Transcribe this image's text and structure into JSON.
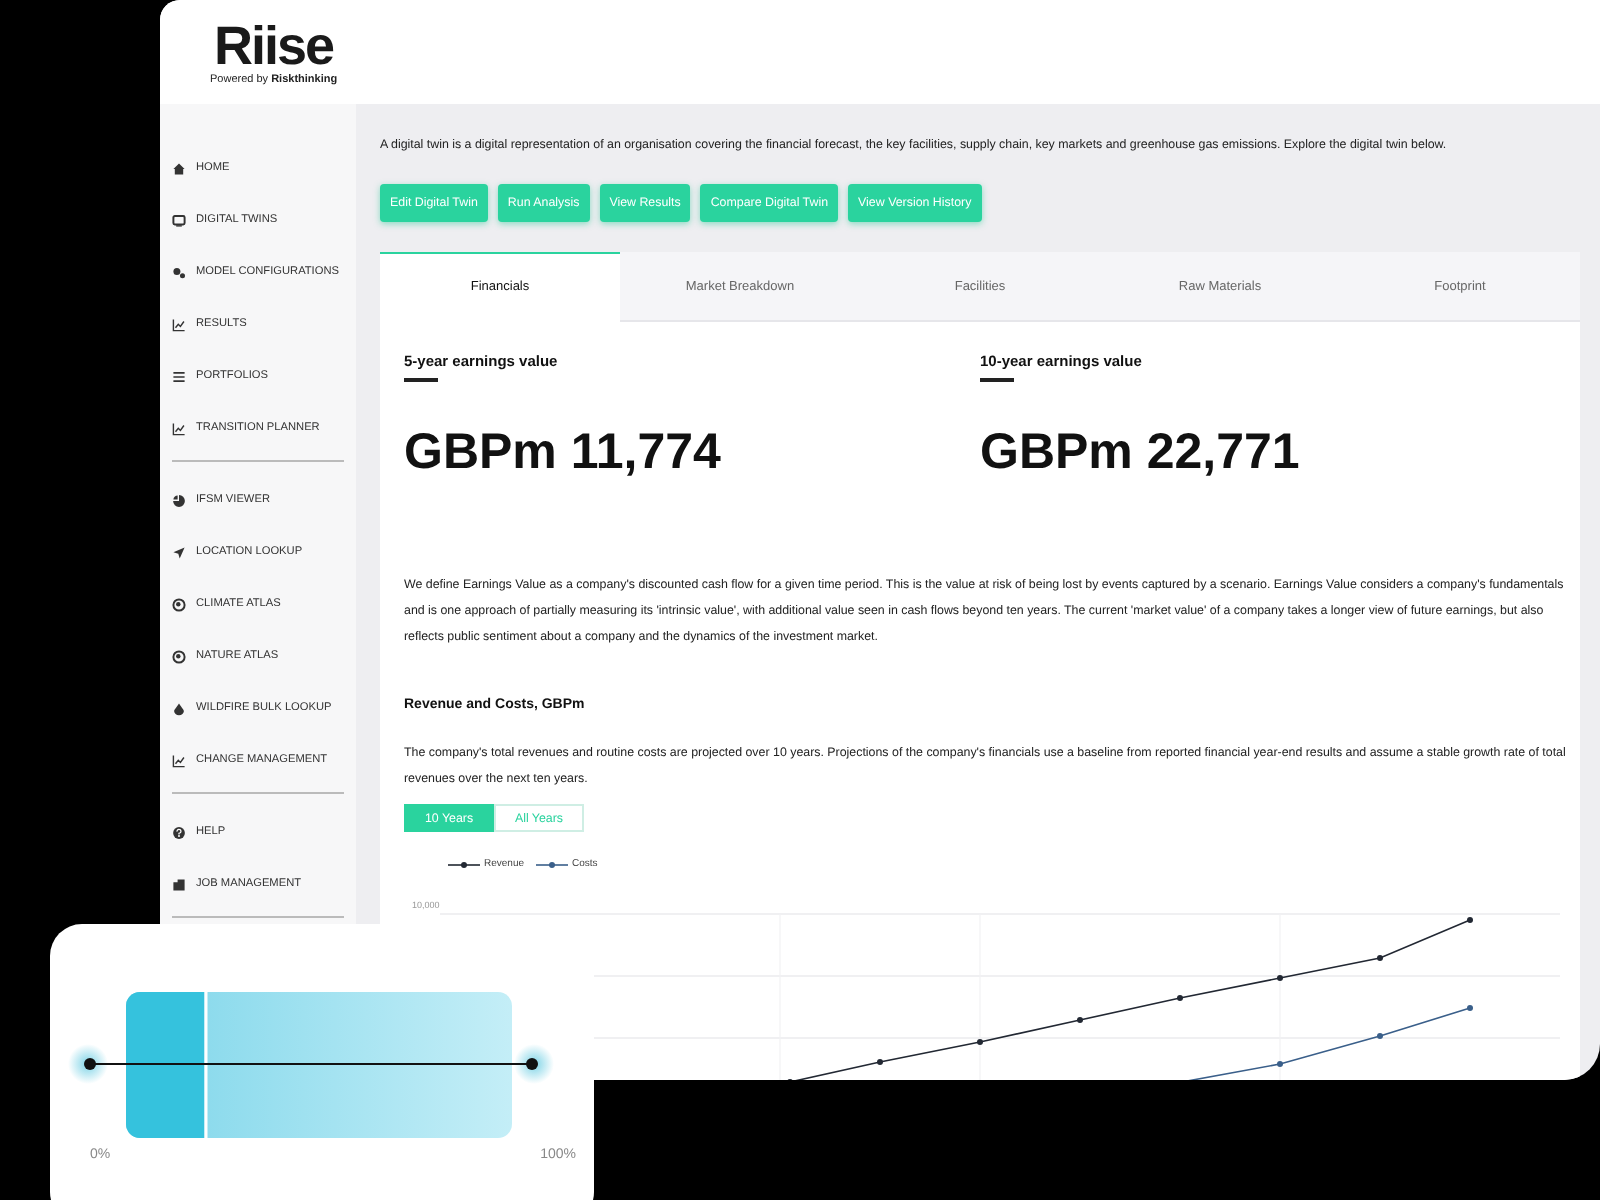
{
  "logo": {
    "name": "Riise",
    "tagline": "Powered by **Riskthinking**"
  },
  "sidebar": {
    "groups": [
      [
        {
          "label": "HOME"
        },
        {
          "label": "DIGITAL TWINS"
        },
        {
          "label": "MODEL CONFIGURATIONS"
        },
        {
          "label": "RESULTS"
        },
        {
          "label": "PORTFOLIOS"
        },
        {
          "label": "TRANSITION PLANNER"
        }
      ],
      [
        {
          "label": "IFSM VIEWER"
        },
        {
          "label": "LOCATION LOOKUP"
        },
        {
          "label": "CLIMATE ATLAS"
        },
        {
          "label": "NATURE ATLAS"
        },
        {
          "label": "WILDFIRE BULK LOOKUP"
        },
        {
          "label": "CHANGE MANAGEMENT"
        }
      ],
      [
        {
          "label": "HELP"
        },
        {
          "label": "JOB MANAGEMENT"
        }
      ]
    ]
  },
  "intro": "A digital twin is a digital representation of an organisation covering the financial forecast, the key facilities, supply chain, key markets and greenhouse gas emissions. Explore the digital twin below.",
  "actions": [
    "Edit Digital Twin",
    "Run Analysis",
    "View Results",
    "Compare Digital Twin",
    "View Version History"
  ],
  "tabs": [
    {
      "label": "Financials",
      "selected": true
    },
    {
      "label": "Market Breakdown",
      "selected": false
    },
    {
      "label": "Facilities",
      "selected": false
    },
    {
      "label": "Raw Materials",
      "selected": false
    },
    {
      "label": "Footprint",
      "selected": false
    }
  ],
  "metrics": [
    {
      "label": "5-year earnings value",
      "value": "GBPm 11,774"
    },
    {
      "label": "10-year earnings value",
      "value": "GBPm 22,771"
    }
  ],
  "definition": "We define Earnings Value as a company's discounted cash flow for a given time period. This is the value at risk of being lost by events captured by a scenario. Earnings Value considers a company's fundamentals and is one approach of partially measuring its 'intrinsic value', with additional value seen in cash flows beyond ten years. The current 'market value' of a company takes a longer view of future earnings, but also reflects public sentiment about a company and the dynamics of the investment market.",
  "revenue_section": {
    "title": "Revenue and Costs, GBPm",
    "text": "The company's total revenues and routine costs are projected over 10 years. Projections of the company's financials use a baseline from reported financial year-end results and assume a stable growth rate of total revenues over the next ten years.",
    "ranges": [
      {
        "label": "10 Years",
        "selected": true
      },
      {
        "label": "All Years",
        "selected": false
      }
    ],
    "legend": [
      {
        "name": "Revenue",
        "color": "#222833"
      },
      {
        "name": "Costs",
        "color": "#3a5f8a"
      }
    ],
    "axis_label": "10,000"
  },
  "overlay": {
    "min_label": "0%",
    "max_label": "100%"
  }
}
